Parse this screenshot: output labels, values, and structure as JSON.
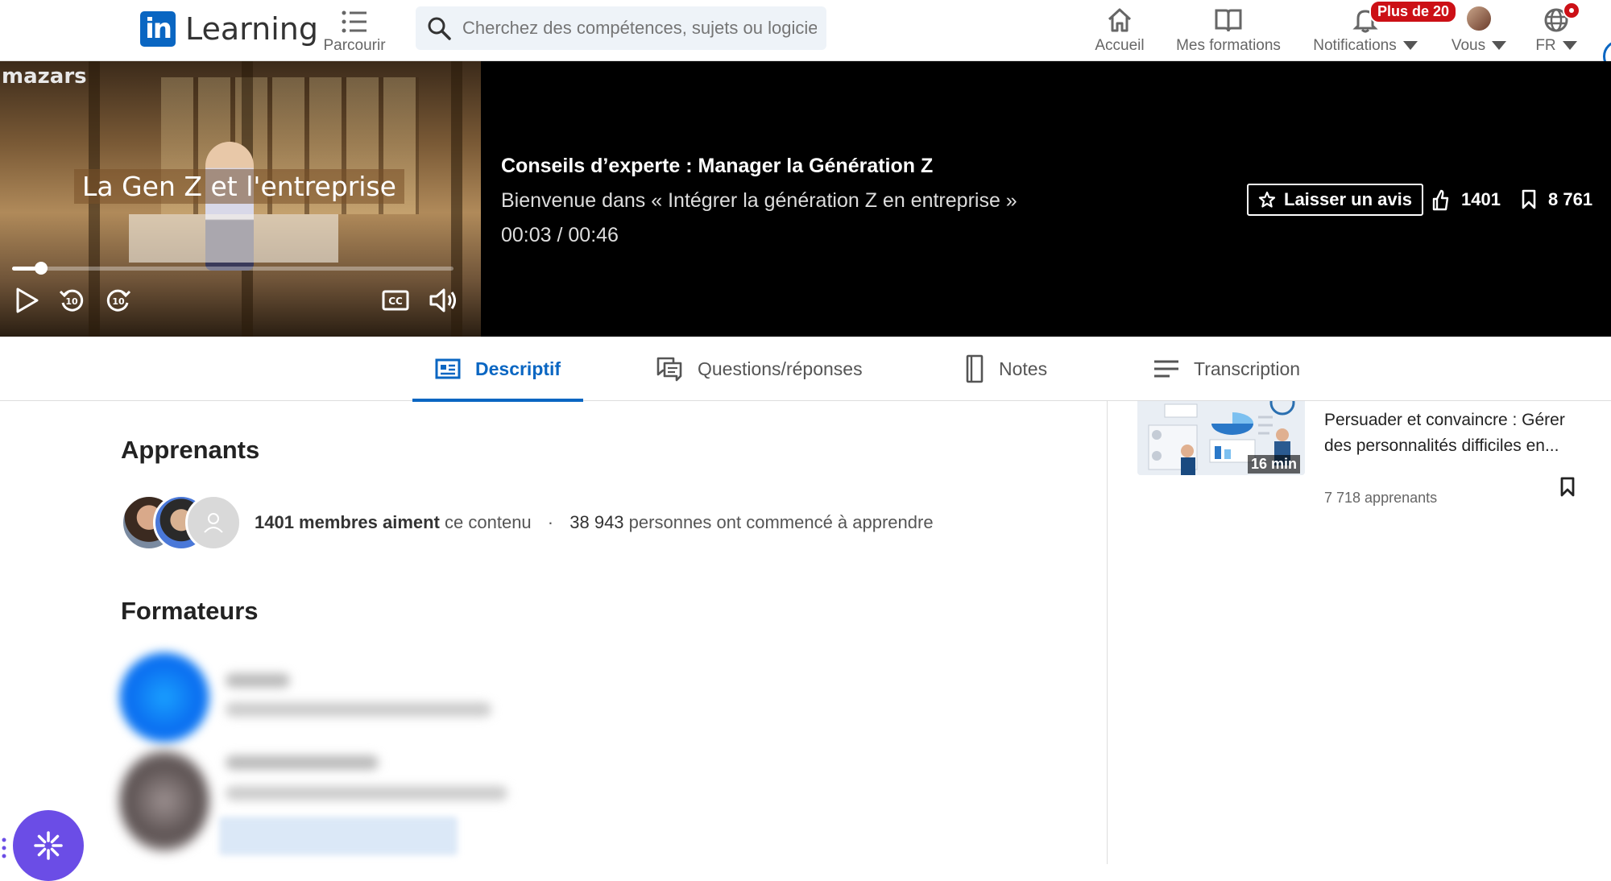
{
  "nav": {
    "logo_text": "Learning",
    "browse_label": "Parcourir",
    "search_placeholder": "Cherchez des compétences, sujets ou logiciels",
    "home_label": "Accueil",
    "courses_label": "Mes formations",
    "notifications_label": "Notifications",
    "notifications_badge": "Plus de 20",
    "me_label": "Vous",
    "lang_label": "FR"
  },
  "player": {
    "brand_watermark": "mazars",
    "video_title_overlay": "La Gen Z et l'entreprise",
    "progress_fraction": 0.065
  },
  "course": {
    "title": "Conseils d’experte : Manager la Génération Z",
    "chapter": "Bienvenue dans « Intégrer la génération Z en entreprise »",
    "time": "00:03 / 00:46",
    "review_label": "Laisser un avis",
    "likes": "1401",
    "saves": "8 761"
  },
  "tabs": [
    {
      "label": "Descriptif",
      "active": true
    },
    {
      "label": "Questions/réponses",
      "active": false
    },
    {
      "label": "Notes",
      "active": false
    },
    {
      "label": "Transcription",
      "active": false
    }
  ],
  "learners": {
    "heading": "Apprenants",
    "likes_count": "1401 membres aiment",
    "likes_suffix": "ce contenu",
    "separator": "·",
    "started_count": "38 943",
    "started_suffix": "personnes ont commencé à apprendre"
  },
  "instructors": {
    "heading": "Formateurs"
  },
  "recommendation": {
    "duration": "16 min",
    "title": "Persuader et convaincre : Gérer des personnalités difficiles en...",
    "learners": "7 718 apprenants"
  },
  "colors": {
    "brand": "#0a66c2",
    "badge": "#cc1016",
    "fab": "#6b4de6"
  }
}
